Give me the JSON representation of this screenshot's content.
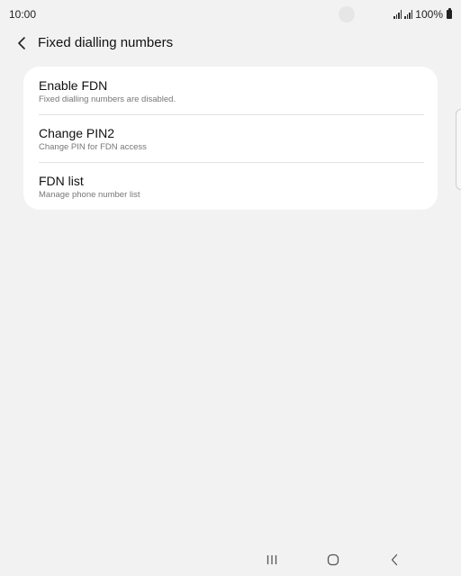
{
  "status_bar": {
    "time": "10:00",
    "battery_text": "100%",
    "icons": [
      "signal-icon",
      "signal-icon",
      "battery-icon"
    ]
  },
  "header": {
    "back_icon": "chevron-left-icon",
    "title": "Fixed dialling numbers"
  },
  "settings": {
    "items": [
      {
        "title": "Enable FDN",
        "subtitle": "Fixed dialling numbers are disabled."
      },
      {
        "title": "Change PIN2",
        "subtitle": "Change PIN for FDN access"
      },
      {
        "title": "FDN list",
        "subtitle": "Manage phone number list"
      }
    ]
  },
  "nav_bar": {
    "icons": [
      "recent-apps-icon",
      "home-icon",
      "back-icon"
    ]
  },
  "colors": {
    "background": "#f2f2f2",
    "card": "#ffffff",
    "divider": "#e3e3e3",
    "subtitle": "#777777"
  }
}
